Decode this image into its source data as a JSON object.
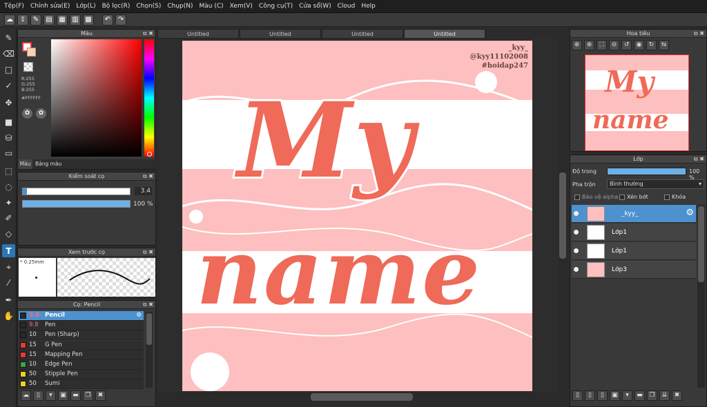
{
  "menu": [
    "Tệp(F)",
    "Chỉnh sửa(E)",
    "Lớp(L)",
    "Bộ lọc(R)",
    "Chọn(S)",
    "Chụp(N)",
    "Màu (C)",
    "Xem(V)",
    "Công cụ(T)",
    "Cửa sổ(W)",
    "Cloud",
    "Help"
  ],
  "color_panel": {
    "title": "Màu",
    "r": "R:255",
    "g": "G:255",
    "b": "B:255",
    "hex": "#FFFFFF",
    "tab1": "Màu",
    "tab2": "Bảng màu"
  },
  "brush_control": {
    "title": "Kiểm soát cọ",
    "size": "3.4",
    "opacity": "100 %",
    "opacity_fraction": 1.0
  },
  "brush_preview": {
    "title": "Xem trước cọ",
    "size": "* 0.25mm"
  },
  "brush_list": {
    "title": "Cọ: Pencil",
    "items": [
      {
        "size": "3.4",
        "name": "Pencil",
        "color": "#2a2a2a"
      },
      {
        "size": "9.8",
        "name": "Pen",
        "color": "#2a2a2a"
      },
      {
        "size": "10",
        "name": "Pen (Sharp)",
        "color": "#2a2a2a"
      },
      {
        "size": "15",
        "name": "G Pen",
        "color": "#e53935"
      },
      {
        "size": "15",
        "name": "Mapping Pen",
        "color": "#e53935"
      },
      {
        "size": "10",
        "name": "Edge Pen",
        "color": "#43a047"
      },
      {
        "size": "50",
        "name": "Stipple Pen",
        "color": "#f0d020"
      },
      {
        "size": "50",
        "name": "Sumi",
        "color": "#f0d020"
      }
    ]
  },
  "tabs": [
    "Untitled",
    "Untitled",
    "Untitled",
    "Untitled"
  ],
  "artwork": {
    "line1": "My",
    "line2": "name",
    "watermark1": "_kyy_",
    "watermark2": "@kyy11102008",
    "watermark3": "#hoidap247"
  },
  "navigator": {
    "title": "Hoa tiêu"
  },
  "layers": {
    "title": "Lớp",
    "opacity_label": "Độ trong",
    "opacity_value": "100 %",
    "opacity_fraction": 1.0,
    "blend_label": "Pha trộn",
    "blend_value": "Bình thường",
    "protect_alpha": "Bảo vệ alpha",
    "clipping": "Xén bớt",
    "lock": "Khóa",
    "items": [
      {
        "name": "_kyy_"
      },
      {
        "name": "Lớp1"
      },
      {
        "name": "Lớp1"
      },
      {
        "name": "Lớp3"
      }
    ]
  }
}
